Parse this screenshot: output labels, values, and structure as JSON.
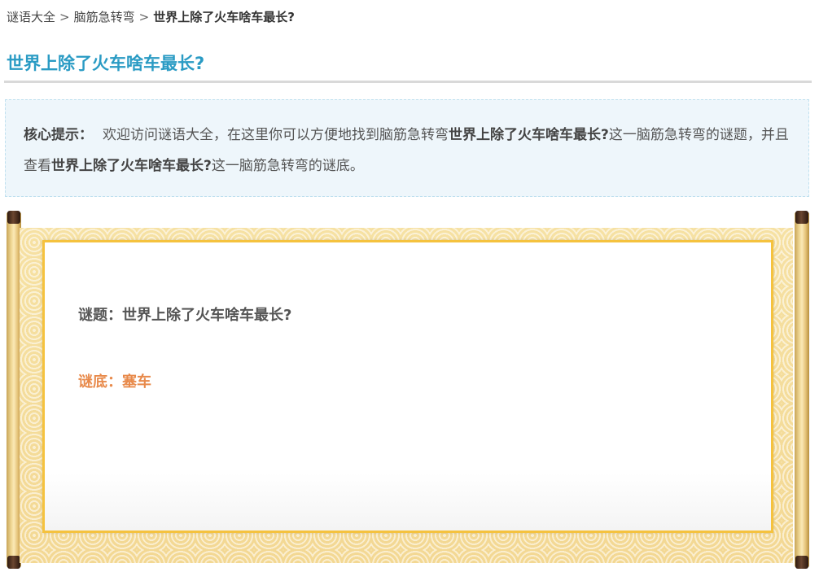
{
  "breadcrumb": {
    "items": [
      "谜语大全",
      "脑筋急转弯"
    ],
    "separator": ">",
    "current": "世界上除了火车啥车最长?"
  },
  "title": "世界上除了火车啥车最长?",
  "hint": {
    "label": "核心提示：",
    "text_1": "欢迎访问谜语大全，在这里你可以方便地找到脑筋急转弯",
    "bold_1": "世界上除了火车啥车最长?",
    "text_2": "这一脑筋急转弯的谜题，并且查看",
    "bold_2": "世界上除了火车啥车最长?",
    "text_3": "这一脑筋急转弯的谜底。"
  },
  "riddle": {
    "question_label": "谜题：",
    "question": "世界上除了火车啥车最长?",
    "answer_label": "谜底：",
    "answer": "塞车"
  },
  "colors": {
    "title": "#2a9bc4",
    "answer": "#e88a4b",
    "scroll_border": "#f5c23e",
    "hint_bg": "#eef6fb"
  }
}
